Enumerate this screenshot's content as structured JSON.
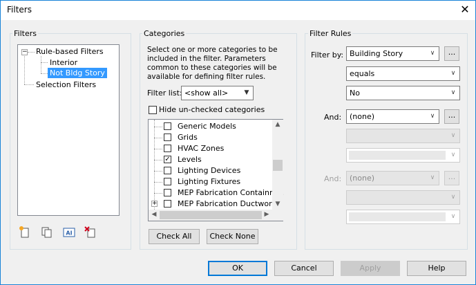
{
  "window": {
    "title": "Filters"
  },
  "filters_panel": {
    "label": "Filters",
    "tree": {
      "rule_based": "Rule-based Filters",
      "interior": "Interior",
      "not_bldg_story": "Not Bldg Story",
      "selection": "Selection Filters"
    },
    "toolbar_icons": [
      "new-filter-icon",
      "duplicate-filter-icon",
      "rename-filter-icon",
      "delete-filter-icon"
    ]
  },
  "categories_panel": {
    "label": "Categories",
    "description": "Select one or more categories to be included in the filter.  Parameters common to these categories will be available for defining filter rules.",
    "filter_list_label": "Filter list:",
    "filter_list_value": "<show all>",
    "hide_unchecked_label": "Hide un-checked categories",
    "items": [
      {
        "label": "Generic Models",
        "checked": false
      },
      {
        "label": "Grids",
        "checked": false
      },
      {
        "label": "HVAC Zones",
        "checked": false
      },
      {
        "label": "Levels",
        "checked": true
      },
      {
        "label": "Lighting Devices",
        "checked": false
      },
      {
        "label": "Lighting Fixtures",
        "checked": false
      },
      {
        "label": "MEP Fabrication Containm...",
        "checked": false
      },
      {
        "label": "MEP Fabrication Ductwork",
        "checked": false
      }
    ],
    "check_all": "Check All",
    "check_none": "Check None"
  },
  "rules_panel": {
    "label": "Filter Rules",
    "filter_by_label": "Filter by:",
    "filter_by_value": "Building Story",
    "operator_value": "equals",
    "value_value": "No",
    "and1_label": "And:",
    "and1_value": "(none)",
    "and2_label": "And:",
    "and2_value": "(none)",
    "dots": "..."
  },
  "footer": {
    "ok": "OK",
    "cancel": "Cancel",
    "apply": "Apply",
    "help": "Help"
  },
  "colors": {
    "selection": "#3399ff",
    "accent_border": "#0078d7"
  }
}
